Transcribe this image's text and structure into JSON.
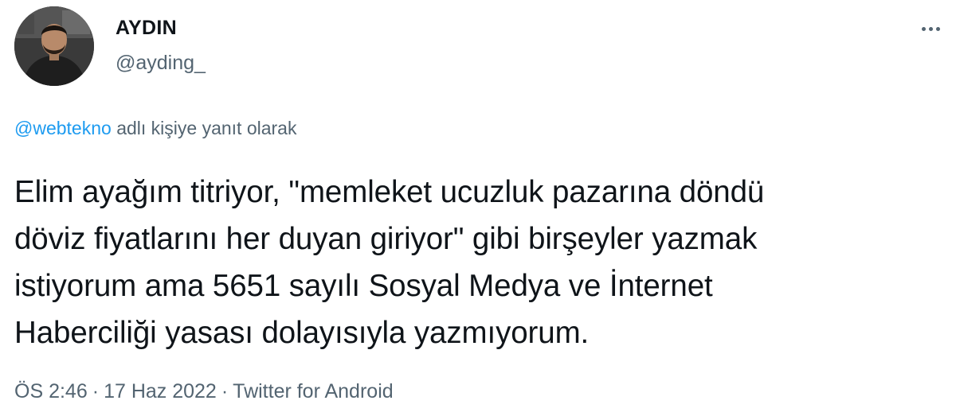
{
  "author": {
    "display_name": "AYDIN",
    "username": "@ayding_"
  },
  "more_menu_icon": "more-horizontal-icon",
  "reply_context": {
    "mention": "@webtekno",
    "text": " adlı kişiye yanıt olarak"
  },
  "tweet": {
    "lines": [
      "Elim ayağım titriyor, \"memleket ucuzluk pazarına döndü",
      "döviz fiyatlarını her duyan giriyor\" gibi birşeyler yazmak",
      "istiyorum ama 5651 sayılı Sosyal Medya ve İnternet",
      "Haberciliği yasası dolayısıyla yazmıyorum."
    ]
  },
  "meta": {
    "time": "ÖS 2:46",
    "separator": "·",
    "date": "17 Haz 2022",
    "source": "Twitter for Android"
  },
  "colors": {
    "text_primary": "#0f1419",
    "text_secondary": "#536471",
    "link": "#1d9bf0"
  }
}
